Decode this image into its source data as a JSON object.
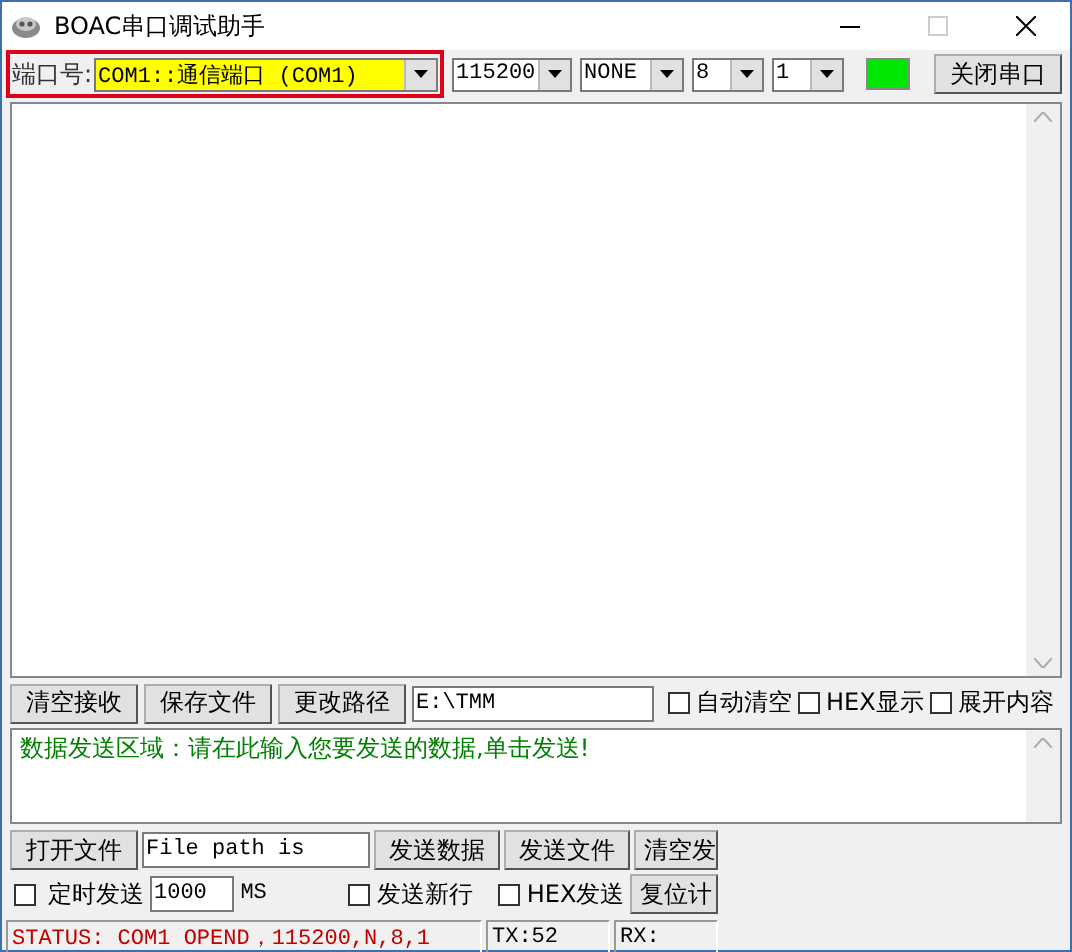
{
  "window": {
    "title": "BOAC串口调试助手"
  },
  "port": {
    "label": "端口号:",
    "value": "COM1::通信端口 (COM1)",
    "highlighted": true
  },
  "settings": [
    {
      "value": "115200"
    },
    {
      "value": "NONE"
    },
    {
      "value": "8"
    },
    {
      "value": "1"
    }
  ],
  "port_open": true,
  "close_button": "关闭串口",
  "receive_bar": {
    "buttons": [
      "清空接收",
      "保存文件",
      "更改路径"
    ],
    "path": "E:\\TMM",
    "checkboxes": [
      {
        "label": "自动清空",
        "checked": false
      },
      {
        "label": "HEX显示",
        "checked": false
      },
      {
        "label": "展开内容",
        "checked": false
      }
    ]
  },
  "send_area": {
    "placeholder": "数据发送区域：请在此输入您要发送的数据,单击发送!"
  },
  "file_bar": {
    "open_button": "打开文件",
    "file_path": "File path is",
    "buttons": [
      "发送数据",
      "发送文件",
      "清空发"
    ]
  },
  "timer_bar": {
    "timer": {
      "label": "定时发送",
      "checked": false
    },
    "interval": "1000",
    "unit": "MS",
    "options": [
      {
        "label": "发送新行",
        "checked": false
      },
      {
        "label": "HEX发送",
        "checked": false
      }
    ],
    "button": "复位计"
  },
  "status_bar": {
    "status": "STATUS: COM1 OPEND，115200,N,8,1",
    "tx": "TX:52",
    "rx": "RX:"
  }
}
